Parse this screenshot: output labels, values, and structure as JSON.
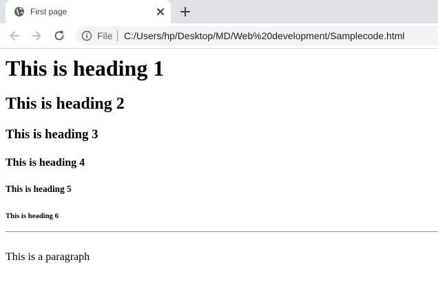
{
  "browser": {
    "tab": {
      "title": "First page",
      "favicon": "globe-icon",
      "close_icon": "close-icon"
    },
    "new_tab_icon": "plus-icon",
    "toolbar": {
      "back_icon": "arrow-left-icon",
      "forward_icon": "arrow-right-icon",
      "reload_icon": "reload-icon",
      "info_icon": "info-icon",
      "scheme_label": "File",
      "url": "C:/Users/hp/Desktop/MD/Web%20development/Samplecode.html"
    },
    "colors": {
      "tabstrip": "#dee1e6",
      "omnibox": "#f1f3f4",
      "icon": "#5f6368"
    }
  },
  "page": {
    "h1": "This is heading 1",
    "h2": "This is heading 2",
    "h3": "This is heading 3",
    "h4": "This is heading 4",
    "h5": "This is heading 5",
    "h6": "This is heading 6",
    "paragraph": "This is a paragraph"
  }
}
